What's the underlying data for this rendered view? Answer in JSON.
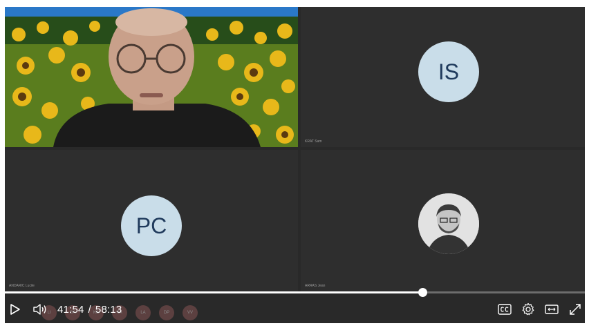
{
  "tiles": {
    "is": {
      "initials": "IS",
      "name": "KRAT Sam"
    },
    "pc": {
      "initials": "PC",
      "name": "ANDARIC Lucile"
    },
    "photo": {
      "name": "ARRAS Jean"
    }
  },
  "player": {
    "current_time": "41:54",
    "separator": "/",
    "duration": "58:13",
    "progress_fraction": 0.72
  },
  "strip": [
    "LI",
    "GA",
    "KS",
    "TA",
    "LA",
    "DP",
    "VV"
  ],
  "icons": [
    "play-icon",
    "volume-icon",
    "captions-icon",
    "settings-icon",
    "theater-icon",
    "fullscreen-icon"
  ]
}
